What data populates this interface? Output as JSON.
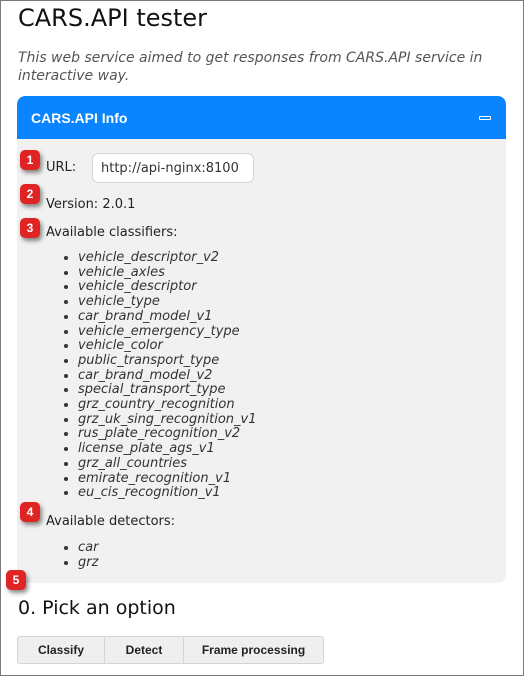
{
  "page": {
    "title": "CARS.API tester",
    "subtitle": "This web service aimed to get responses from CARS.API service in interactive way."
  },
  "info_panel": {
    "title": "CARS.API Info",
    "collapse_icon": "minus-icon",
    "url_label": "URL:",
    "url_value": "http://api-nginx:8100",
    "version_text": "Version: 2.0.1",
    "classifiers_label": "Available classifiers:",
    "classifiers": [
      "vehicle_descriptor_v2",
      "vehicle_axles",
      "vehicle_descriptor",
      "vehicle_type",
      "car_brand_model_v1",
      "vehicle_emergency_type",
      "vehicle_color",
      "public_transport_type",
      "car_brand_model_v2",
      "special_transport_type",
      "grz_country_recognition",
      "grz_uk_sing_recognition_v1",
      "rus_plate_recognition_v2",
      "license_plate_ags_v1",
      "grz_all_countries",
      "emirate_recognition_v1",
      "eu_cis_recognition_v1"
    ],
    "detectors_label": "Available detectors:",
    "detectors": [
      "car",
      "grz"
    ]
  },
  "badges": [
    "1",
    "2",
    "3",
    "4",
    "5"
  ],
  "options": {
    "heading": "0. Pick an option",
    "buttons": [
      "Classify",
      "Detect",
      "Frame processing"
    ]
  },
  "colors": {
    "accent": "#0a84ff",
    "panel_bg": "#f1f1f1",
    "badge": "#e02424"
  }
}
